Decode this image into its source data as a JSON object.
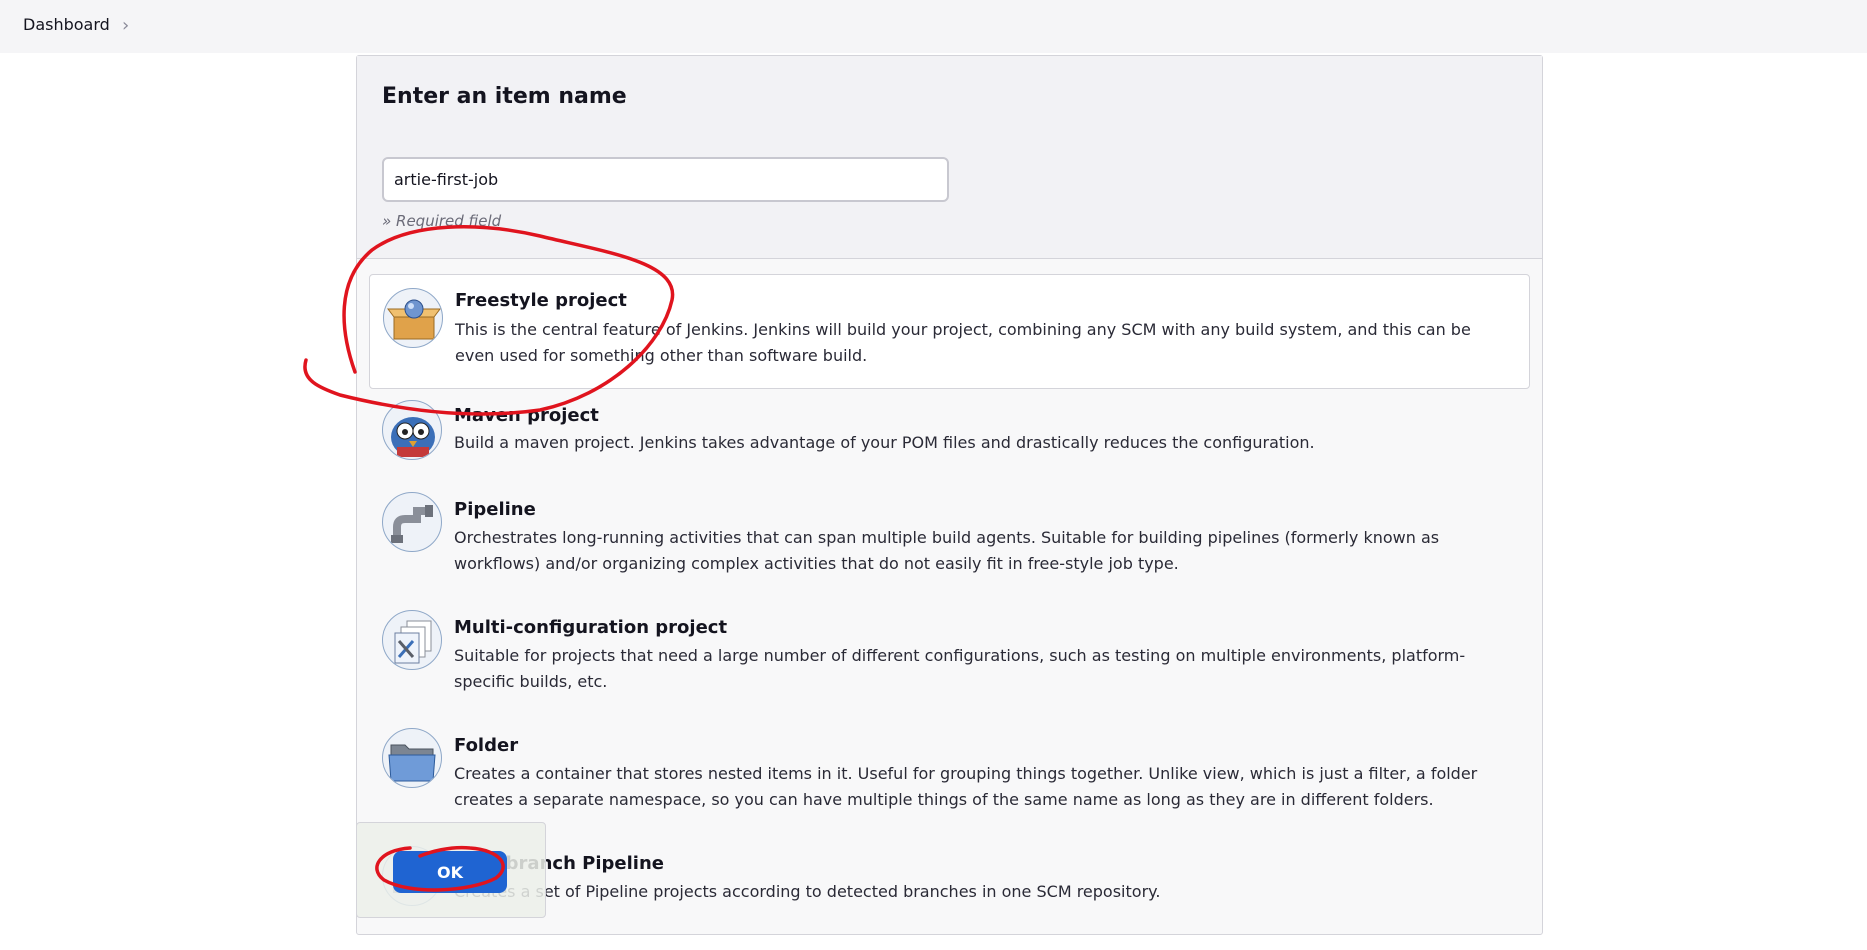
{
  "breadcrumb": {
    "dashboard": "Dashboard",
    "separator": "›"
  },
  "form": {
    "title": "Enter an item name",
    "item_name_value": "artie-first-job",
    "required_note": "» Required field"
  },
  "items": [
    {
      "name": "Freestyle project",
      "desc": "This is the central feature of Jenkins. Jenkins will build your project, combining any SCM with any build system, and this can be even used for something other than software build.",
      "icon": "freestyle-project-icon",
      "selected": true
    },
    {
      "name": "Maven project",
      "desc": "Build a maven project. Jenkins takes advantage of your POM files and drastically reduces the configuration.",
      "icon": "maven-project-icon"
    },
    {
      "name": "Pipeline",
      "desc": "Orchestrates long-running activities that can span multiple build agents. Suitable for building pipelines (formerly known as workflows) and/or organizing complex activities that do not easily fit in free-style job type.",
      "icon": "pipeline-icon"
    },
    {
      "name": "Multi-configuration project",
      "desc": "Suitable for projects that need a large number of different configurations, such as testing on multiple environments, platform-specific builds, etc.",
      "icon": "multi-configuration-icon"
    },
    {
      "name": "Folder",
      "desc": "Creates a container that stores nested items in it. Useful for grouping things together. Unlike view, which is just a filter, a folder creates a separate namespace, so you can have multiple things of the same name as long as they are in different folders.",
      "icon": "folder-icon"
    },
    {
      "name": "Multibranch Pipeline",
      "desc": "Creates a set of Pipeline projects according to detected branches in one SCM repository.",
      "icon": "multibranch-pipeline-icon"
    }
  ],
  "ok_button": {
    "label": "OK"
  },
  "colors": {
    "accent": "#1f64d2",
    "annotation": "#e0141e"
  }
}
